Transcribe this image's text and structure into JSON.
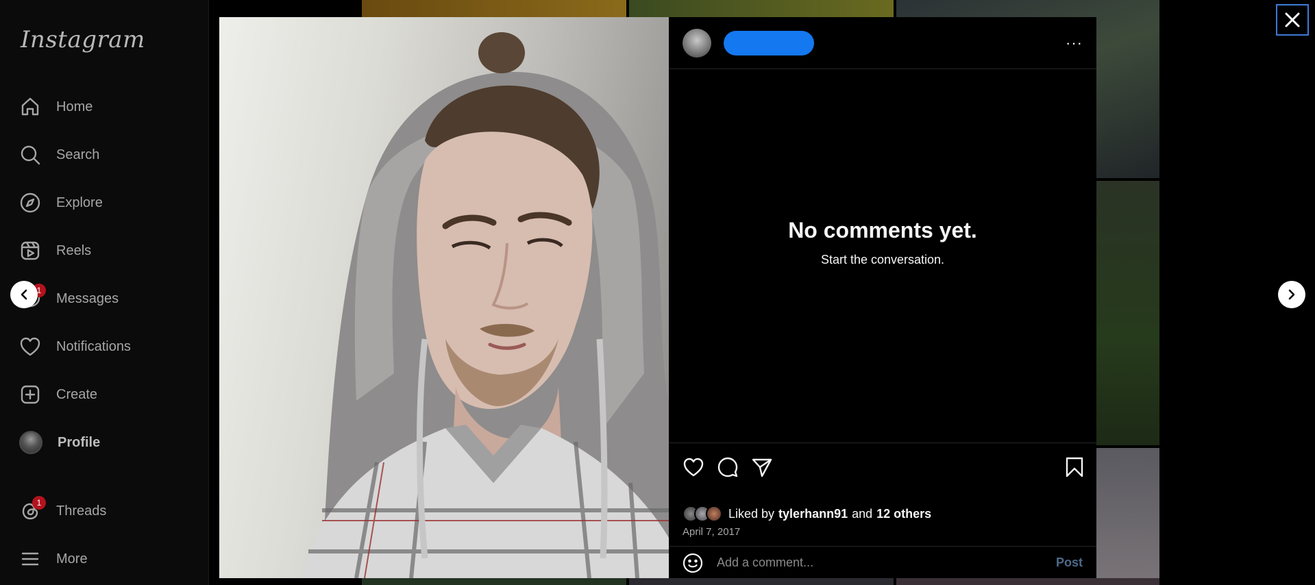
{
  "app": {
    "logo": "Instagram"
  },
  "sidebar": {
    "items": [
      {
        "label": "Home",
        "icon": "home-icon"
      },
      {
        "label": "Search",
        "icon": "search-icon"
      },
      {
        "label": "Explore",
        "icon": "compass-icon"
      },
      {
        "label": "Reels",
        "icon": "reels-icon"
      },
      {
        "label": "Messages",
        "icon": "messenger-icon",
        "badge": "1"
      },
      {
        "label": "Notifications",
        "icon": "heart-icon"
      },
      {
        "label": "Create",
        "icon": "plus-square-icon"
      },
      {
        "label": "Profile",
        "icon": "avatar"
      },
      {
        "label": "Threads",
        "icon": "threads-icon",
        "badge": "1"
      },
      {
        "label": "More",
        "icon": "hamburger-icon"
      }
    ]
  },
  "post": {
    "comments_empty_title": "No comments yet.",
    "comments_empty_subtitle": "Start the conversation.",
    "liked_by_prefix": "Liked by",
    "liked_by_user": "tylerhann91",
    "liked_by_and": "and",
    "liked_by_others": "12 others",
    "date": "April 7, 2017",
    "comment_placeholder": "Add a comment...",
    "post_button": "Post",
    "more_glyph": "···"
  },
  "colors": {
    "background": "#000000",
    "redaction": "#1478f0",
    "close_focus": "#3d7bd6",
    "badge": "#b3131e",
    "post_button_disabled": "#4d6a8a"
  }
}
